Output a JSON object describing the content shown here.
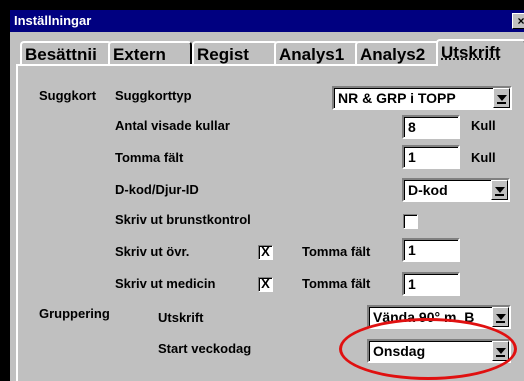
{
  "window": {
    "title": "Inställningar",
    "close_glyph": "×"
  },
  "tabs": [
    {
      "label": "Besättnii",
      "active": false
    },
    {
      "label": "Extern",
      "active": false
    },
    {
      "label": "Regist",
      "active": false
    },
    {
      "label": "Analys1",
      "active": false
    },
    {
      "label": "Analys2",
      "active": false
    },
    {
      "label": "Utskrift",
      "active": true
    }
  ],
  "suggkort": {
    "section_label": "Suggkort",
    "type_label": "Suggkorttyp",
    "type_value": "NR & GRP i TOPP",
    "antal_label": "Antal visade kullar",
    "antal_value": "8",
    "antal_unit": "Kull",
    "tomma_label": "Tomma fält",
    "tomma_value": "1",
    "tomma_unit": "Kull",
    "dkod_label": "D-kod/Djur-ID",
    "dkod_value": "D-kod",
    "brunst_label": "Skriv ut brunstkontrol",
    "brunst_checked": "",
    "ovr_label": "Skriv ut övr.",
    "ovr_checked": "X",
    "ovr_tomma_label": "Tomma fält",
    "ovr_tomma_value": "1",
    "medicin_label": "Skriv ut medicin",
    "medicin_checked": "X",
    "medicin_tomma_label": "Tomma fält",
    "medicin_tomma_value": "1"
  },
  "gruppering": {
    "section_label": "Gruppering",
    "utskrift_label": "Utskrift",
    "utskrift_value": "Vända 90° m. B",
    "veckodag_label": "Start veckodag",
    "veckodag_value": "Onsdag"
  },
  "annotation": {
    "color": "#e01010"
  },
  "icons": {
    "close": "close-icon",
    "dropdown": "chevron-down-icon"
  }
}
